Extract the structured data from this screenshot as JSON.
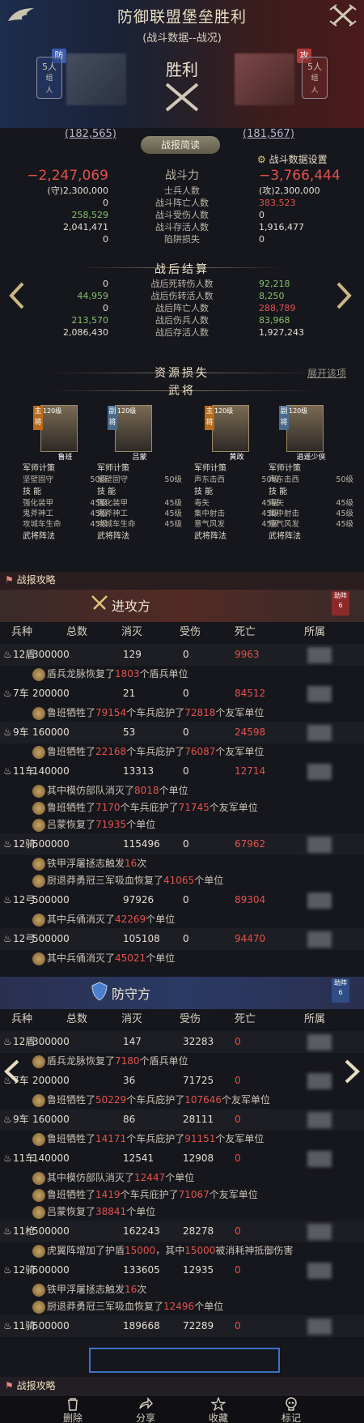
{
  "header": {
    "title": "防御联盟堡垒胜利",
    "subtitle": "(战斗数据--战况)",
    "result": "胜利",
    "attacker": {
      "tag": "防",
      "count": "5人",
      "sub": "组\n人",
      "power": "(182,565)"
    },
    "defender": {
      "tag": "攻",
      "count": "5人",
      "sub": "组\n人",
      "power": "(181,567)"
    },
    "report_button": "战报简读",
    "settings_button": "战斗数据设置"
  },
  "stats": {
    "rows": [
      {
        "left": "−2,247,069",
        "mid": "战斗力",
        "right": "−3,766,444"
      },
      {
        "left": "(守)2,300,000",
        "mid": "士兵人数",
        "right": "(攻)2,300,000"
      },
      {
        "left": "0",
        "mid": "战斗阵亡人数",
        "right": "383,523"
      },
      {
        "left": "258,529",
        "mid": "战斗受伤人数",
        "right": "0"
      },
      {
        "left": "2,041,471",
        "mid": "战斗存活人数",
        "right": "1,916,477"
      },
      {
        "left": "0",
        "mid": "陷阱损失",
        "right": "0"
      }
    ],
    "after_title": "战后结算",
    "after_rows": [
      {
        "left": "0",
        "mid": "战后死转伤人数",
        "right": "92,218"
      },
      {
        "left": "44,959",
        "mid": "战后伤转活人数",
        "right": "8,250"
      },
      {
        "left": "0",
        "mid": "战后阵亡人数",
        "right": "288,789"
      },
      {
        "left": "213,570",
        "mid": "战后伤兵人数",
        "right": "83,968"
      },
      {
        "left": "2,086,430",
        "mid": "战后存活人数",
        "right": "1,927,243"
      }
    ],
    "resource_title": "资源损失",
    "expand_label": "展开该项",
    "general_title": "武将"
  },
  "generals": [
    {
      "badge": "主\n将",
      "level": "120级",
      "name": "鲁班",
      "l1": "军师计策",
      "k1": "坚壁固守",
      "v1": "50级",
      "l2": "技 能",
      "s1": "强化装甲",
      "v2": "45级",
      "s2": "鬼斧神工",
      "v3": "45级",
      "s3": "攻城车生命",
      "v4": "45级",
      "f": "武将阵法"
    },
    {
      "badge": "副\n将",
      "level": "120级",
      "name": "吕蒙",
      "l1": "军师计策",
      "k1": "坚壁固守",
      "v1": "50级",
      "l2": "技 能",
      "s1": "强化装甲",
      "v2": "45级",
      "s2": "鬼斧神工",
      "v3": "45级",
      "s3": "攻城车生命",
      "v4": "45级",
      "f": "武将阵法"
    },
    {
      "badge": "主\n将",
      "level": "120级",
      "name": "黄政",
      "l1": "军师计策",
      "k1": "声东击西",
      "v1": "50级",
      "l2": "技 能",
      "s1": "毒矢",
      "v2": "45级",
      "s2": "集中射击",
      "v3": "45级",
      "s3": "意气风发",
      "v4": "45级",
      "f": "武将阵法"
    },
    {
      "badge": "副\n将",
      "level": "120级",
      "name": "逍遥少侠",
      "l1": "军师计策",
      "k1": "声东击西",
      "v1": "50级",
      "l2": "技 能",
      "s1": "毒矢",
      "v2": "45级",
      "s2": "集中射击",
      "v3": "45级",
      "s3": "意气风发",
      "v4": "45级",
      "f": "武将阵法"
    }
  ],
  "battle_tab": "战报攻略",
  "columns": [
    "兵种",
    "总数",
    "消灭",
    "受伤",
    "死亡",
    "所属"
  ],
  "attack": {
    "title": "进攻方",
    "helper": "助阵\n6",
    "rows": [
      {
        "type": "12盾",
        "total": "300000",
        "kill": "129",
        "hurt": "0",
        "dead": "9963",
        "lines": [
          [
            "盾兵龙脉恢复了",
            "1803",
            "个盾兵单位"
          ]
        ]
      },
      {
        "type": "7车",
        "total": "200000",
        "kill": "21",
        "hurt": "0",
        "dead": "84512",
        "lines": [
          [
            "鲁班牺牲了",
            "79154",
            "个车兵庇护了",
            "72818",
            "个友军单位"
          ]
        ]
      },
      {
        "type": "9车",
        "total": "160000",
        "kill": "53",
        "hurt": "0",
        "dead": "24598",
        "lines": [
          [
            "鲁班牺牲了",
            "22168",
            "个车兵庇护了",
            "76087",
            "个友军单位"
          ]
        ]
      },
      {
        "type": "11车",
        "total": "140000",
        "kill": "13313",
        "hurt": "0",
        "dead": "12714",
        "lines": [
          [
            "其中模仿部队消灭了",
            "8018",
            "个单位"
          ],
          [
            "鲁班牺牲了",
            "7170",
            "个车兵庇护了",
            "71745",
            "个友军单位"
          ],
          [
            "吕蒙恢复了",
            "71935",
            "个单位"
          ]
        ]
      },
      {
        "type": "12骑",
        "total": "500000",
        "kill": "115496",
        "hurt": "0",
        "dead": "67962",
        "lines": [
          [
            "铁甲浮屠拯志触发",
            "16",
            "次"
          ],
          [
            "厨退莽勇冠三军吸血恢复了",
            "41065",
            "个单位"
          ]
        ]
      },
      {
        "type": "12弓",
        "total": "500000",
        "kill": "97926",
        "hurt": "0",
        "dead": "89304",
        "lines": [
          [
            "其中兵俑消灭了",
            "42269",
            "个单位"
          ]
        ]
      },
      {
        "type": "12弓",
        "total": "500000",
        "kill": "105108",
        "hurt": "0",
        "dead": "94470",
        "lines": [
          [
            "其中兵俑消灭了",
            "45021",
            "个单位"
          ]
        ]
      }
    ]
  },
  "defense": {
    "title": "防守方",
    "helper": "助阵\n6",
    "rows": [
      {
        "type": "12盾",
        "total": "300000",
        "kill": "147",
        "hurt": "32283",
        "dead": "0",
        "lines": [
          [
            "盾兵龙脉恢复了",
            "7180",
            "个盾兵单位"
          ]
        ]
      },
      {
        "type": "7车",
        "total": "200000",
        "kill": "36",
        "hurt": "71725",
        "dead": "0",
        "lines": [
          [
            "鲁班牺牲了",
            "50229",
            "个车兵庇护了",
            "107646",
            "个友军单位"
          ]
        ]
      },
      {
        "type": "9车",
        "total": "160000",
        "kill": "86",
        "hurt": "28111",
        "dead": "0",
        "lines": [
          [
            "鲁班牺牲了",
            "14171",
            "个车兵庇护了",
            "91151",
            "个友军单位"
          ]
        ]
      },
      {
        "type": "11车",
        "total": "140000",
        "kill": "12541",
        "hurt": "12908",
        "dead": "0",
        "lines": [
          [
            "其中模仿部队消灭了",
            "12447",
            "个单位"
          ],
          [
            "鲁班牺牲了",
            "1419",
            "个车兵庇护了",
            "71067",
            "个友军单位"
          ],
          [
            "吕蒙恢复了",
            "38841",
            "个单位"
          ]
        ]
      },
      {
        "type": "11枪",
        "total": "500000",
        "kill": "162243",
        "hurt": "28278",
        "dead": "0",
        "lines": [
          [
            "虎翼阵增加了护盾",
            "15000",
            "，其中",
            "15000",
            "被消耗神抵御伤害"
          ]
        ]
      },
      {
        "type": "12骑",
        "total": "500000",
        "kill": "133605",
        "hurt": "12935",
        "dead": "0",
        "lines": [
          [
            "铁甲浮屠拯志触发",
            "16",
            "次"
          ],
          [
            "厨退莽勇冠三军吸血恢复了",
            "12496",
            "个单位"
          ]
        ]
      },
      {
        "type": "11骑",
        "total": "500000",
        "kill": "189668",
        "hurt": "72289",
        "dead": "0",
        "lines": []
      }
    ]
  },
  "footer": {
    "delete": "删除",
    "share": "分享",
    "collect": "收藏",
    "mark": "标记"
  }
}
